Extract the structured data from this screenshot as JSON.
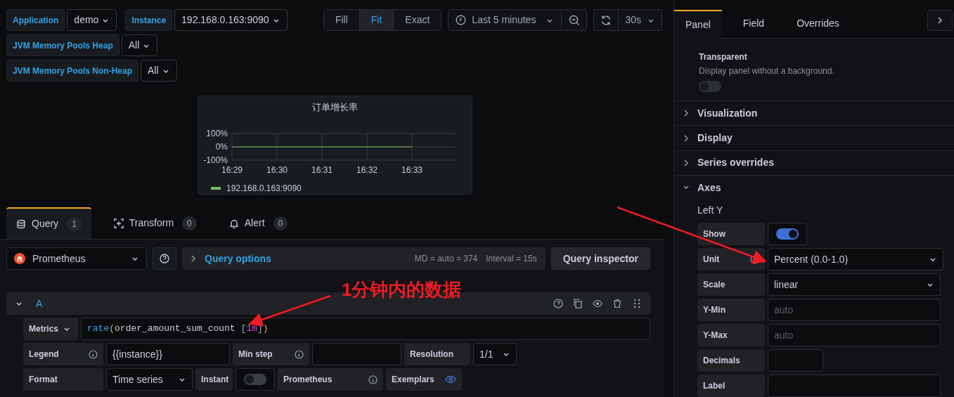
{
  "variables": [
    [
      {
        "label": "Application",
        "value": "demo"
      },
      {
        "label": "Instance",
        "value": "192.168.0.163:9090"
      }
    ],
    [
      {
        "label": "JVM Memory Pools Heap",
        "value": "All"
      }
    ],
    [
      {
        "label": "JVM Memory Pools Non-Heap",
        "value": "All"
      }
    ]
  ],
  "time_controls": {
    "zoom_modes": [
      {
        "label": "Fill",
        "selected": false
      },
      {
        "label": "Fit",
        "selected": true
      },
      {
        "label": "Exact",
        "selected": false
      }
    ],
    "time_range": "Last 5 minutes",
    "refresh_interval": "30s"
  },
  "panel": {
    "title": "订单增长率",
    "chart_data": {
      "type": "line",
      "x": [
        "16:29",
        "16:30",
        "16:31",
        "16:32",
        "16:33"
      ],
      "series": [
        {
          "name": "192.168.0.163:9090",
          "color": "#73bf69",
          "values": [
            0,
            0,
            0,
            0,
            0
          ]
        }
      ],
      "ylim": [
        -1,
        1
      ],
      "yticks": [
        {
          "value": 1,
          "label": "100%"
        },
        {
          "value": 0,
          "label": "0%"
        },
        {
          "value": -1,
          "label": "-100%"
        }
      ],
      "grid": true
    }
  },
  "query_tabs": [
    {
      "label": "Query",
      "count": "1",
      "selected": true
    },
    {
      "label": "Transform",
      "count": "0",
      "selected": false
    },
    {
      "label": "Alert",
      "count": "0",
      "selected": false
    }
  ],
  "datasource": {
    "name": "Prometheus"
  },
  "query_options": {
    "label": "Query options",
    "max_data_points": "MD = auto = 374",
    "interval": "Interval = 15s",
    "inspector_button": "Query inspector"
  },
  "query": {
    "ref_id": "A",
    "expanded": true,
    "metrics_label": "Metrics",
    "tokens": [
      {
        "text": "rate",
        "kind": "function"
      },
      {
        "text": "(",
        "kind": "paren"
      },
      {
        "text": "order_amount_sum_count ",
        "kind": "metric"
      },
      {
        "text": "[",
        "kind": "bracket"
      },
      {
        "text": "1m",
        "kind": "duration"
      },
      {
        "text": "]",
        "kind": "bracket"
      },
      {
        "text": ")",
        "kind": "paren"
      }
    ],
    "rows": [
      [
        {
          "kind": "label",
          "text": "Legend",
          "info": true
        },
        {
          "kind": "input",
          "value": "{{instance}}"
        },
        {
          "kind": "label",
          "text": "Min step",
          "info": true
        },
        {
          "kind": "input"
        },
        {
          "kind": "label",
          "text": "Resolution"
        },
        {
          "kind": "select",
          "value": "1/1"
        }
      ],
      [
        {
          "kind": "label",
          "text": "Format"
        },
        {
          "kind": "select",
          "value": "Time series"
        },
        {
          "kind": "label",
          "text": "Instant"
        },
        {
          "kind": "switch",
          "on": false
        },
        {
          "kind": "label",
          "text": "Prometheus",
          "info": true
        },
        {
          "kind": "label",
          "text": "Exemplars",
          "eye": true
        }
      ]
    ]
  },
  "options_panel": {
    "tabs": [
      {
        "label": "Panel",
        "selected": true
      },
      {
        "label": "Field",
        "selected": false
      },
      {
        "label": "Overrides",
        "selected": false
      }
    ],
    "transparent": {
      "title": "Transparent",
      "description": "Display panel without a background.",
      "on": false
    },
    "sections": [
      {
        "title": "Visualization",
        "expanded": false
      },
      {
        "title": "Display",
        "expanded": false
      },
      {
        "title": "Series overrides",
        "expanded": false
      },
      {
        "title": "Axes",
        "expanded": true
      }
    ],
    "axes": {
      "subtitle": "Left Y",
      "rows": [
        {
          "kind": "switch",
          "label": "Show",
          "on": true
        },
        {
          "kind": "select",
          "label": "Unit",
          "info": true,
          "value": "Percent (0.0-1.0)"
        },
        {
          "kind": "select",
          "label": "Scale",
          "value": "linear"
        },
        {
          "kind": "input",
          "label": "Y-Min",
          "placeholder": "auto"
        },
        {
          "kind": "input",
          "label": "Y-Max",
          "placeholder": "auto"
        },
        {
          "kind": "input",
          "label": "Decimals"
        },
        {
          "kind": "input",
          "label": "Label"
        }
      ]
    }
  },
  "annotation": {
    "text": "1分钟内的数据"
  }
}
